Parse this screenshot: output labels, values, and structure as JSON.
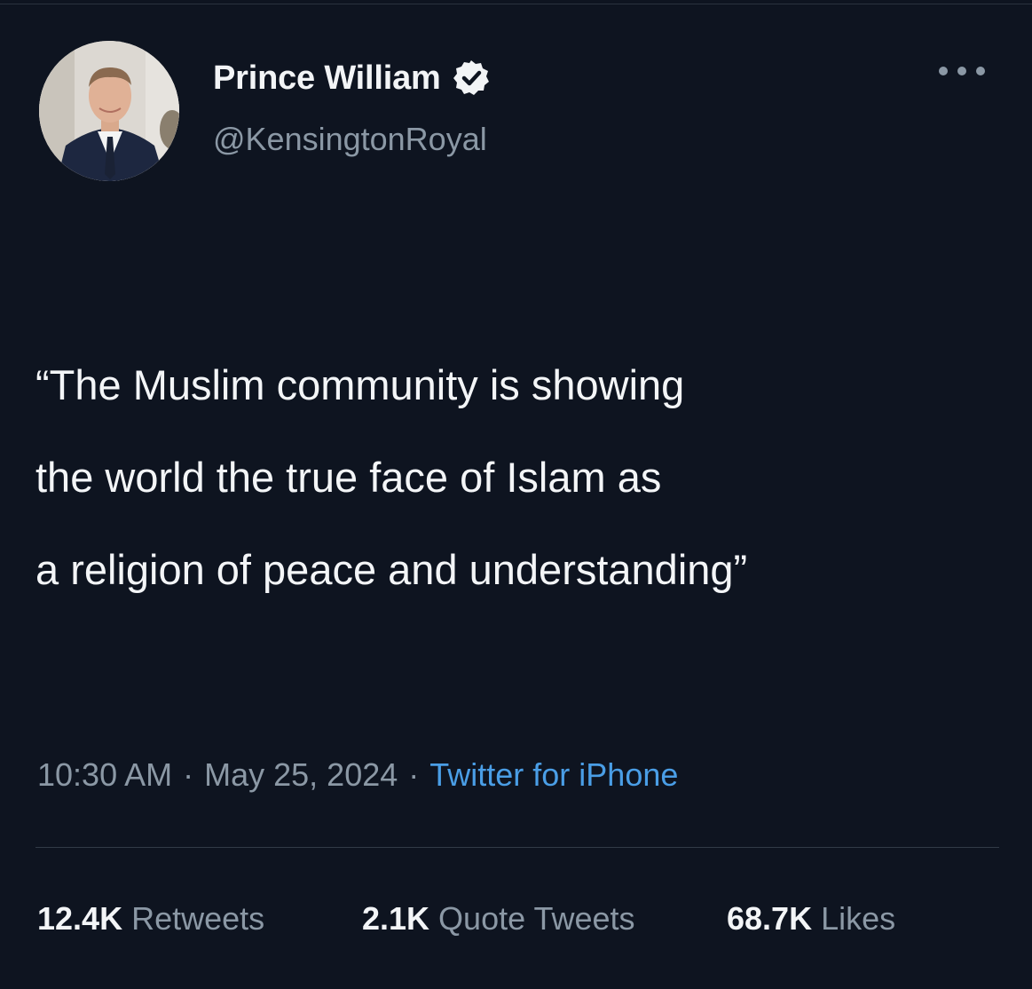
{
  "author": {
    "display_name": "Prince William",
    "handle": "@KensingtonRoyal",
    "verified": true
  },
  "tweet": {
    "text_lines": [
      "“The Muslim community is showing",
      "the world the true face of Islam as",
      "a religion of peace and understanding”"
    ]
  },
  "meta": {
    "time": "10:30 AM",
    "separator": "·",
    "date": "May 25, 2024",
    "source": "Twitter for iPhone"
  },
  "stats": {
    "retweets": {
      "value": "12.4K",
      "label": "Retweets"
    },
    "quote_tweets": {
      "value": "2.1K",
      "label": "Quote Tweets"
    },
    "likes": {
      "value": "68.7K",
      "label": "Likes"
    }
  },
  "icons": {
    "verified": "verified-badge-icon",
    "more": "more-options-icon"
  },
  "colors": {
    "background": "#0e1420",
    "text_primary": "#f3f5f7",
    "text_secondary": "#8b98a5",
    "link": "#4a9ee6"
  }
}
